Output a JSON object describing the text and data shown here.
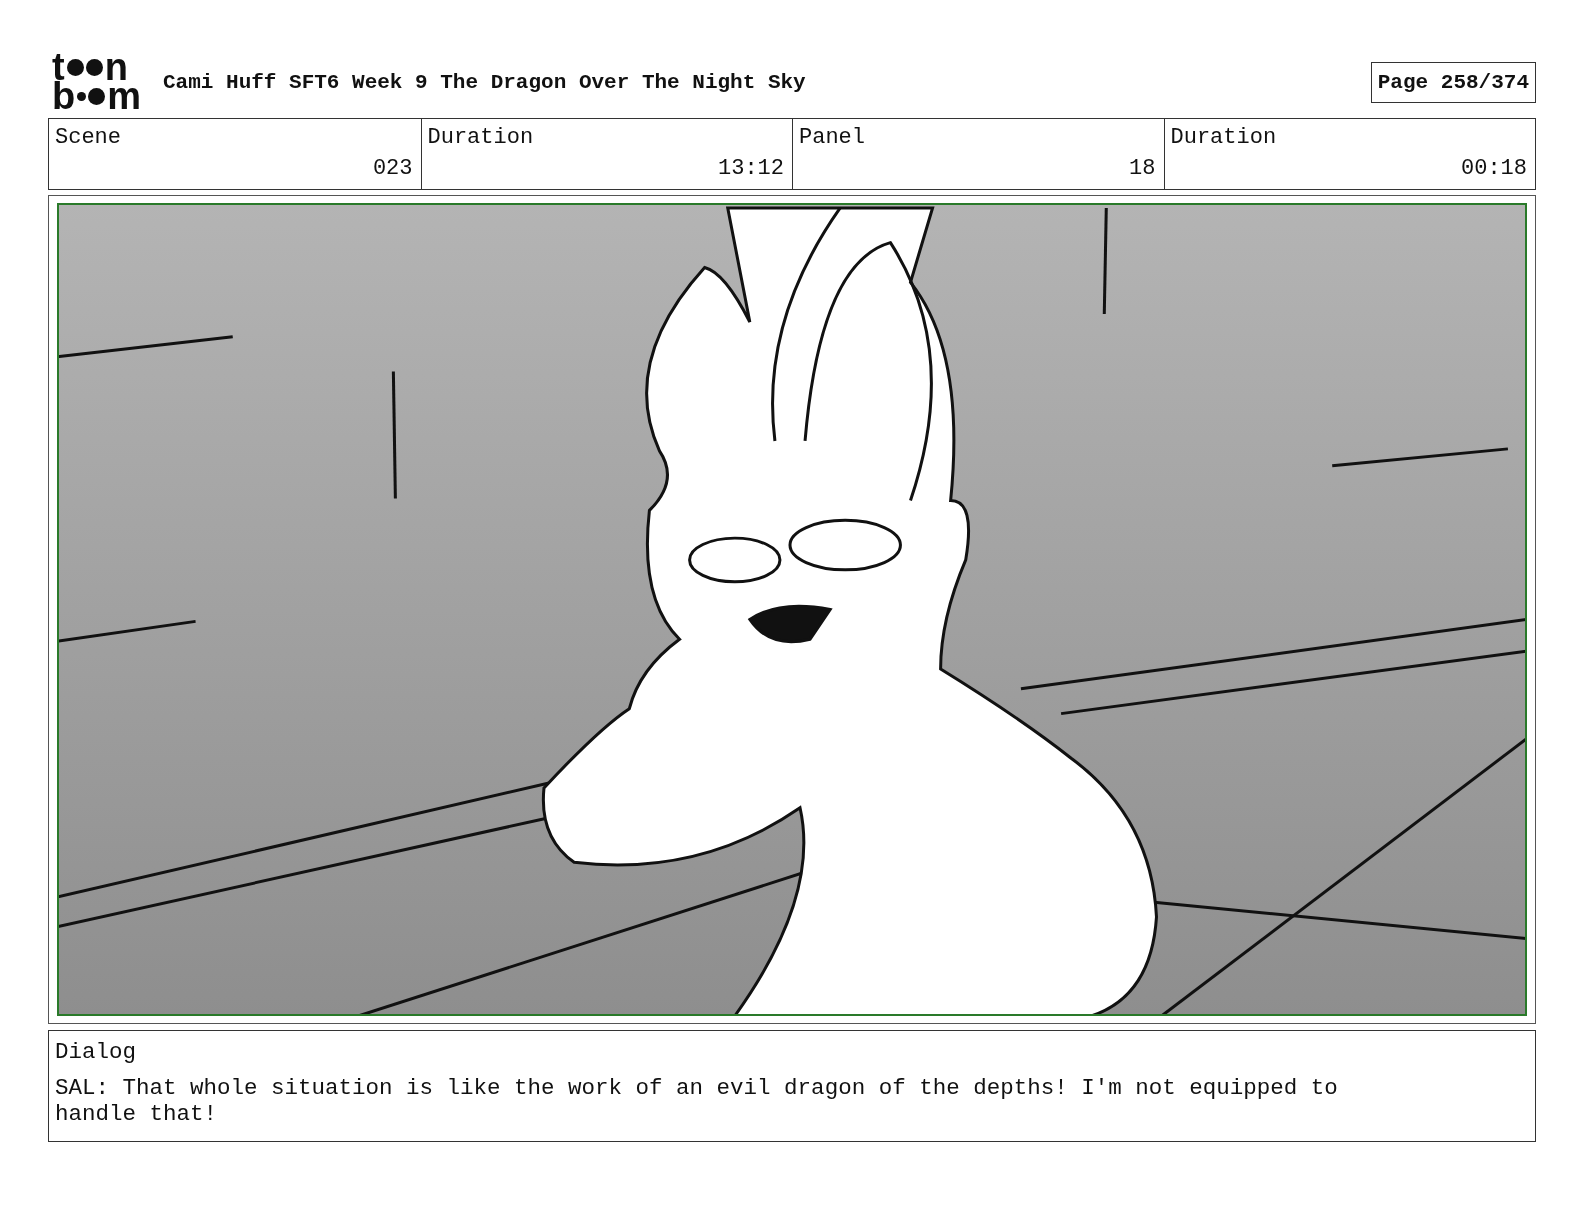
{
  "header": {
    "logo": {
      "line_1": [
        "t",
        "n"
      ],
      "line_2": [
        "b",
        "m"
      ]
    },
    "title": "Cami Huff SFT6 Week 9 The Dragon Over The Night Sky",
    "page": "Page 258/374"
  },
  "info": {
    "labels": [
      "Scene",
      "Duration",
      "Panel",
      "Duration"
    ],
    "values": [
      "023",
      "13:12",
      "18",
      "00:18"
    ]
  },
  "dialog": {
    "label": "Dialog",
    "text": "SAL: That whole situation is like the work of an evil dragon of the depths! I'm not equipped to handle that!"
  }
}
